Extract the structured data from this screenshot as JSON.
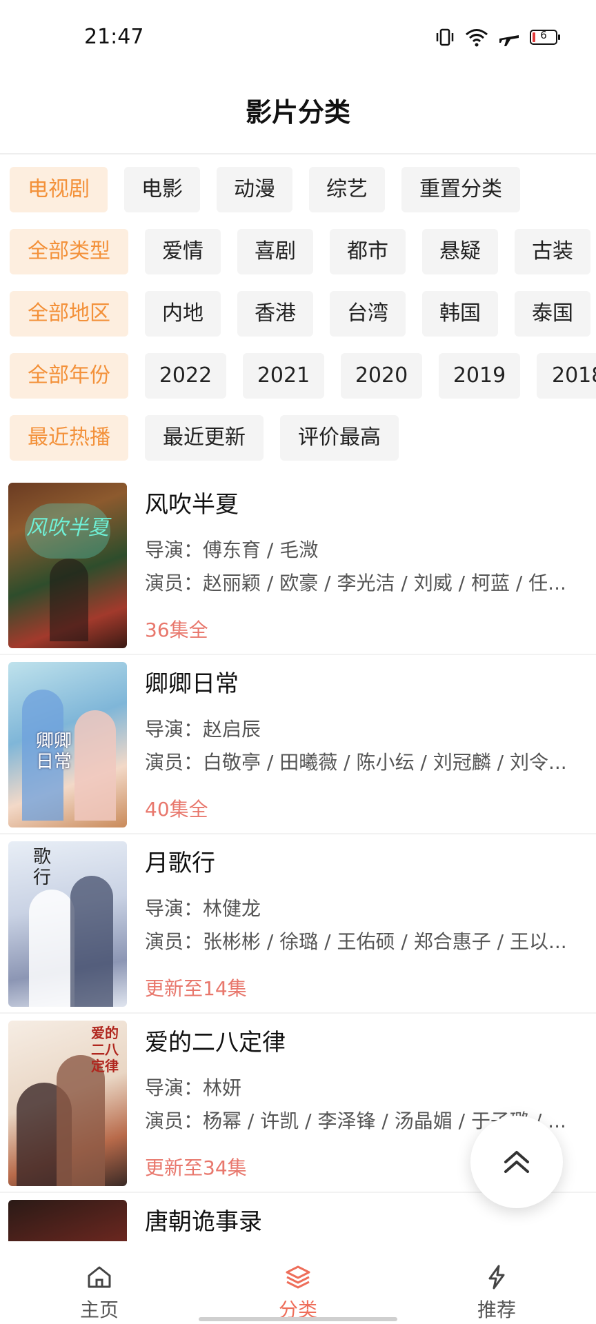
{
  "status_bar": {
    "time": "21:47",
    "battery": "6"
  },
  "header": {
    "title": "影片分类"
  },
  "filters": {
    "category": {
      "active": "电视剧",
      "options": [
        "电影",
        "动漫",
        "综艺",
        "重置分类"
      ]
    },
    "genre": {
      "active": "全部类型",
      "options": [
        "爱情",
        "喜剧",
        "都市",
        "悬疑",
        "古装"
      ]
    },
    "region": {
      "active": "全部地区",
      "options": [
        "内地",
        "香港",
        "台湾",
        "韩国",
        "泰国"
      ]
    },
    "year": {
      "active": "全部年份",
      "options": [
        "2022",
        "2021",
        "2020",
        "2019",
        "2018"
      ]
    },
    "sort": {
      "active": "最近热播",
      "options": [
        "最近更新",
        "评价最高"
      ]
    }
  },
  "movies": [
    {
      "title": "风吹半夏",
      "director": "导演：傅东育 / 毛溦",
      "cast": "演员：赵丽颖 / 欧豪 / 李光洁 / 刘威 / 柯蓝 / 任...",
      "status": "36集全",
      "poster_text": "风吹半夏"
    },
    {
      "title": "卿卿日常",
      "director": "导演：赵启辰",
      "cast": "演员：白敬亭 / 田曦薇 / 陈小纭 / 刘冠麟 / 刘令...",
      "status": "40集全",
      "poster_text": "卿卿日常"
    },
    {
      "title": "月歌行",
      "director": "导演：林健龙",
      "cast": "演员：张彬彬 / 徐璐 / 王佑硕 / 郑合惠子 / 王以...",
      "status": "更新至14集",
      "poster_text": "歌行"
    },
    {
      "title": "爱的二八定律",
      "director": "导演：林妍",
      "cast": "演员：杨幂 / 许凯 / 李泽锋 / 汤晶媚 / 于子璐 / ...",
      "status": "更新至34集",
      "poster_text": "爱的二八定律"
    },
    {
      "title": "唐朝诡事录",
      "director": "",
      "cast": "",
      "status": "",
      "poster_text": ""
    }
  ],
  "bottom_nav": {
    "items": [
      {
        "label": "主页"
      },
      {
        "label": "分类"
      },
      {
        "label": "推荐"
      }
    ],
    "active": "分类"
  },
  "colors": {
    "accent": "#f3913a",
    "active_chip_bg": "#fdeedf",
    "status": "#e8776c",
    "nav_active": "#ee6e5a"
  },
  "icons": [
    "vibrate-icon",
    "wifi-icon",
    "airplane-icon",
    "battery-icon",
    "chevrons-up-icon",
    "home-icon",
    "layers-icon",
    "lightning-icon"
  ]
}
